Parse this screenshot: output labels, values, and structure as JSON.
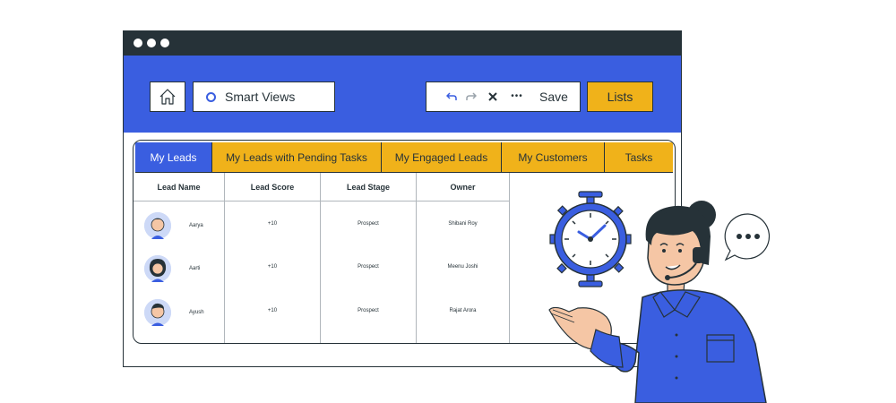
{
  "window": {
    "title_dots": [
      "dot",
      "dot",
      "dot"
    ]
  },
  "header": {
    "smart_views_label": "Smart Views",
    "save_label": "Save",
    "lists_label": "Lists",
    "more_label": "•••"
  },
  "tabs": [
    {
      "label": "My Leads",
      "active": true
    },
    {
      "label": "My Leads with Pending Tasks",
      "active": false
    },
    {
      "label": "My Engaged Leads",
      "active": false
    },
    {
      "label": "My Customers",
      "active": false
    },
    {
      "label": "Tasks",
      "active": false
    }
  ],
  "table": {
    "columns": [
      "Lead Name",
      "Lead Score",
      "Lead Stage",
      "Owner"
    ],
    "rows": [
      {
        "name": "Aarya",
        "score": "+10",
        "stage": "Prospect",
        "owner": "Shibani Roy"
      },
      {
        "name": "Aarti",
        "score": "+10",
        "stage": "Prospect",
        "owner": "Meenu Joshi"
      },
      {
        "name": "Ayush",
        "score": "+10",
        "stage": "Prospect",
        "owner": "Rajat Arora"
      }
    ]
  },
  "colors": {
    "brand_blue": "#3a5ee0",
    "accent_yellow": "#f0b21a",
    "dark": "#263238"
  },
  "icons": {
    "home": "home-icon",
    "undo": "undo-icon",
    "redo": "redo-icon",
    "close": "close-icon",
    "stopwatch": "stopwatch-icon",
    "speech_bubble": "speech-bubble-icon"
  }
}
